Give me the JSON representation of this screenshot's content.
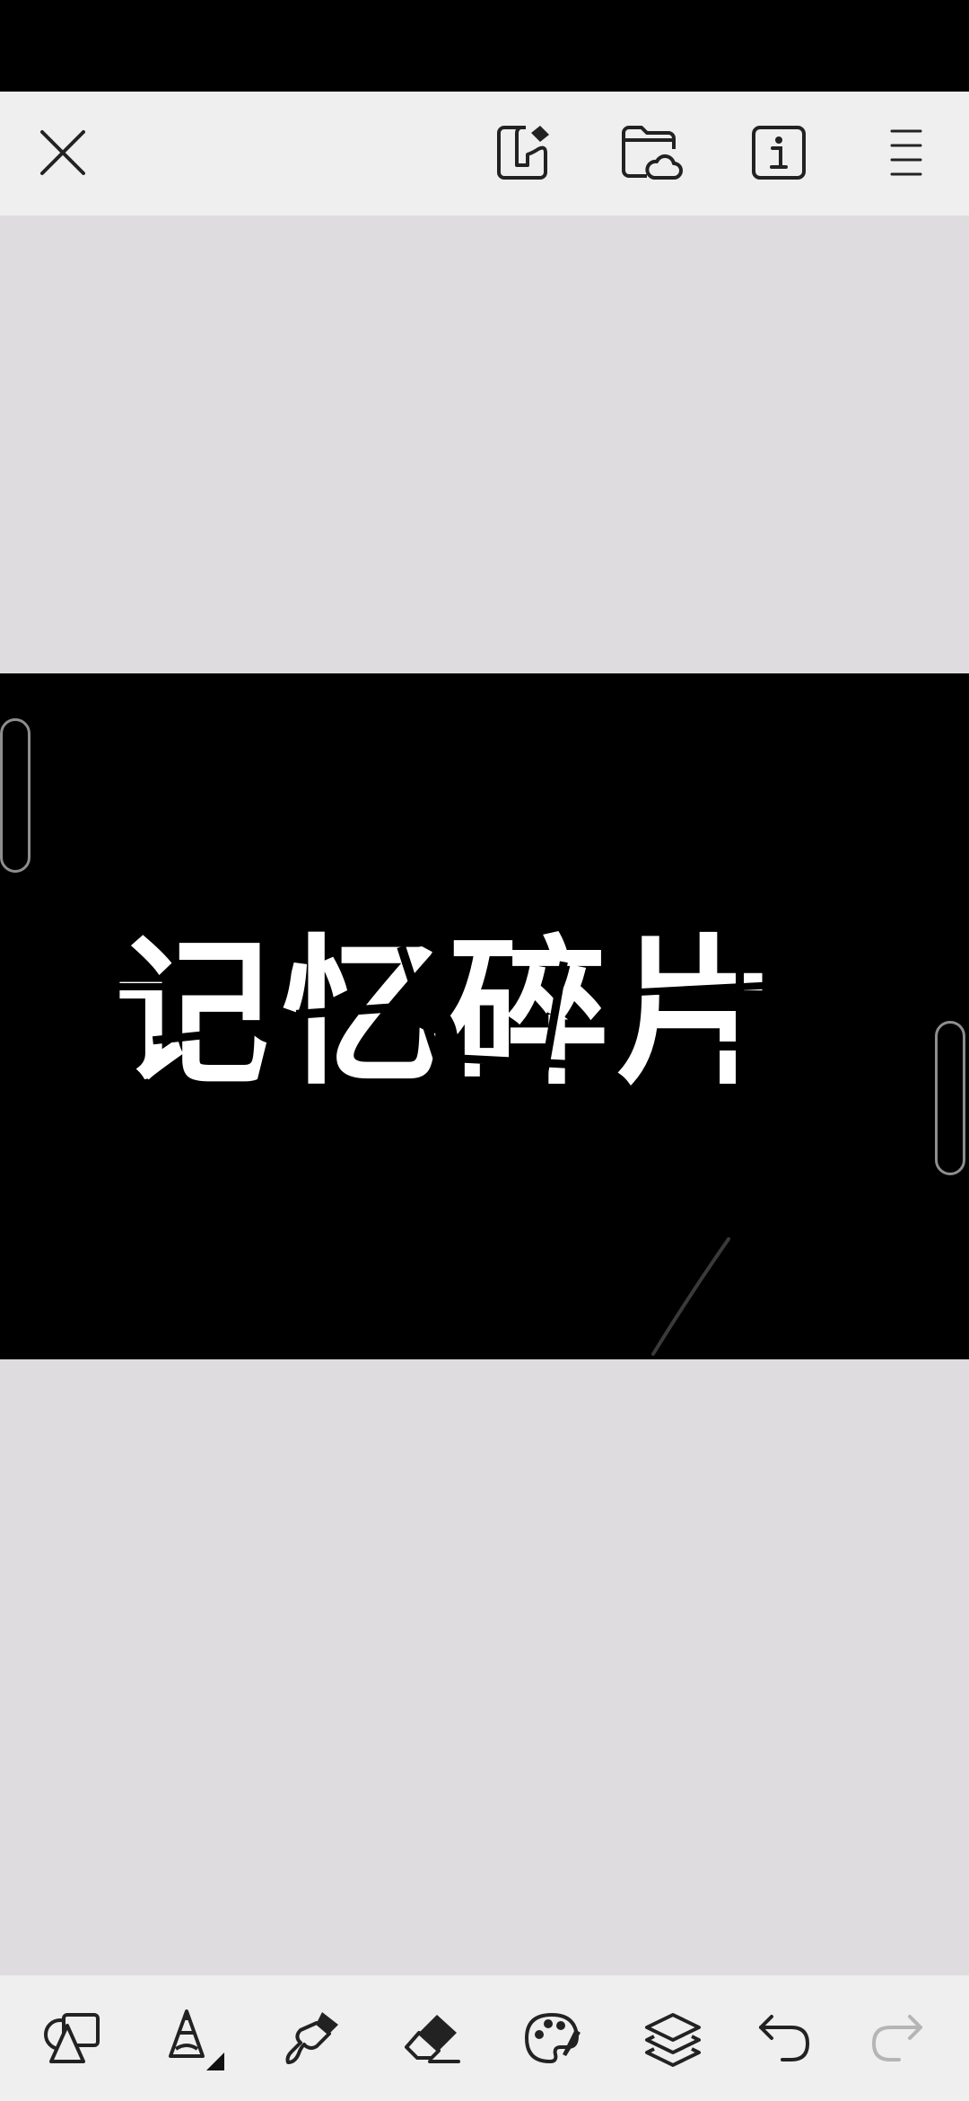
{
  "top_toolbar": {
    "icons": [
      "close-icon",
      "edit-note-icon",
      "cloud-folder-icon",
      "info-icon",
      "menu-icon"
    ]
  },
  "canvas": {
    "artwork_text": "记忆碎片",
    "background_color": "#000000",
    "text_color": "#ffffff"
  },
  "bottom_toolbar": {
    "icons": [
      "shapes-icon",
      "pencil-icon",
      "smudge-icon",
      "eraser-icon",
      "palette-icon",
      "layers-icon",
      "undo-icon",
      "redo-icon"
    ],
    "redo_enabled": false
  },
  "colors": {
    "toolbar_bg": "#efeff0",
    "workspace_bg": "#dedcdf",
    "icon": "#222222",
    "icon_disabled": "#b5b5b5"
  }
}
